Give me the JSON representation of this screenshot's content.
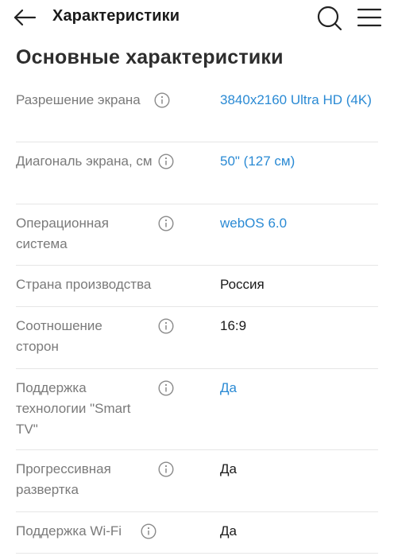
{
  "header": {
    "title": "Характеристики",
    "back_icon": "arrow-left-icon",
    "search_icon": "search-icon",
    "menu_icon": "hamburger-menu-icon"
  },
  "section": {
    "title": "Основные характеристики"
  },
  "specs": [
    {
      "label": "Разрешение экрана",
      "value": "3840x2160 Ultra HD (4K)",
      "link": true
    },
    {
      "label": "Диагональ экрана, см",
      "value": "50\" (127 см)",
      "link": true
    },
    {
      "label": "Операционная система",
      "value": "webOS 6.0",
      "link": true
    },
    {
      "label": "Страна производства",
      "value": "Россия",
      "link": false
    },
    {
      "label": "Соотношение сторон",
      "value": "16:9",
      "link": false
    },
    {
      "label": "Поддержка технологии \"Smart TV\"",
      "value": "Да",
      "link": true
    },
    {
      "label": "Прогрессивная развертка",
      "value": "Да",
      "link": false
    },
    {
      "label": "Поддержка Wi-Fi",
      "value": "Да",
      "link": false
    }
  ],
  "colors": {
    "link": "#2a8ad4",
    "label": "#7a7a7a",
    "divider": "#e6e6e6"
  }
}
